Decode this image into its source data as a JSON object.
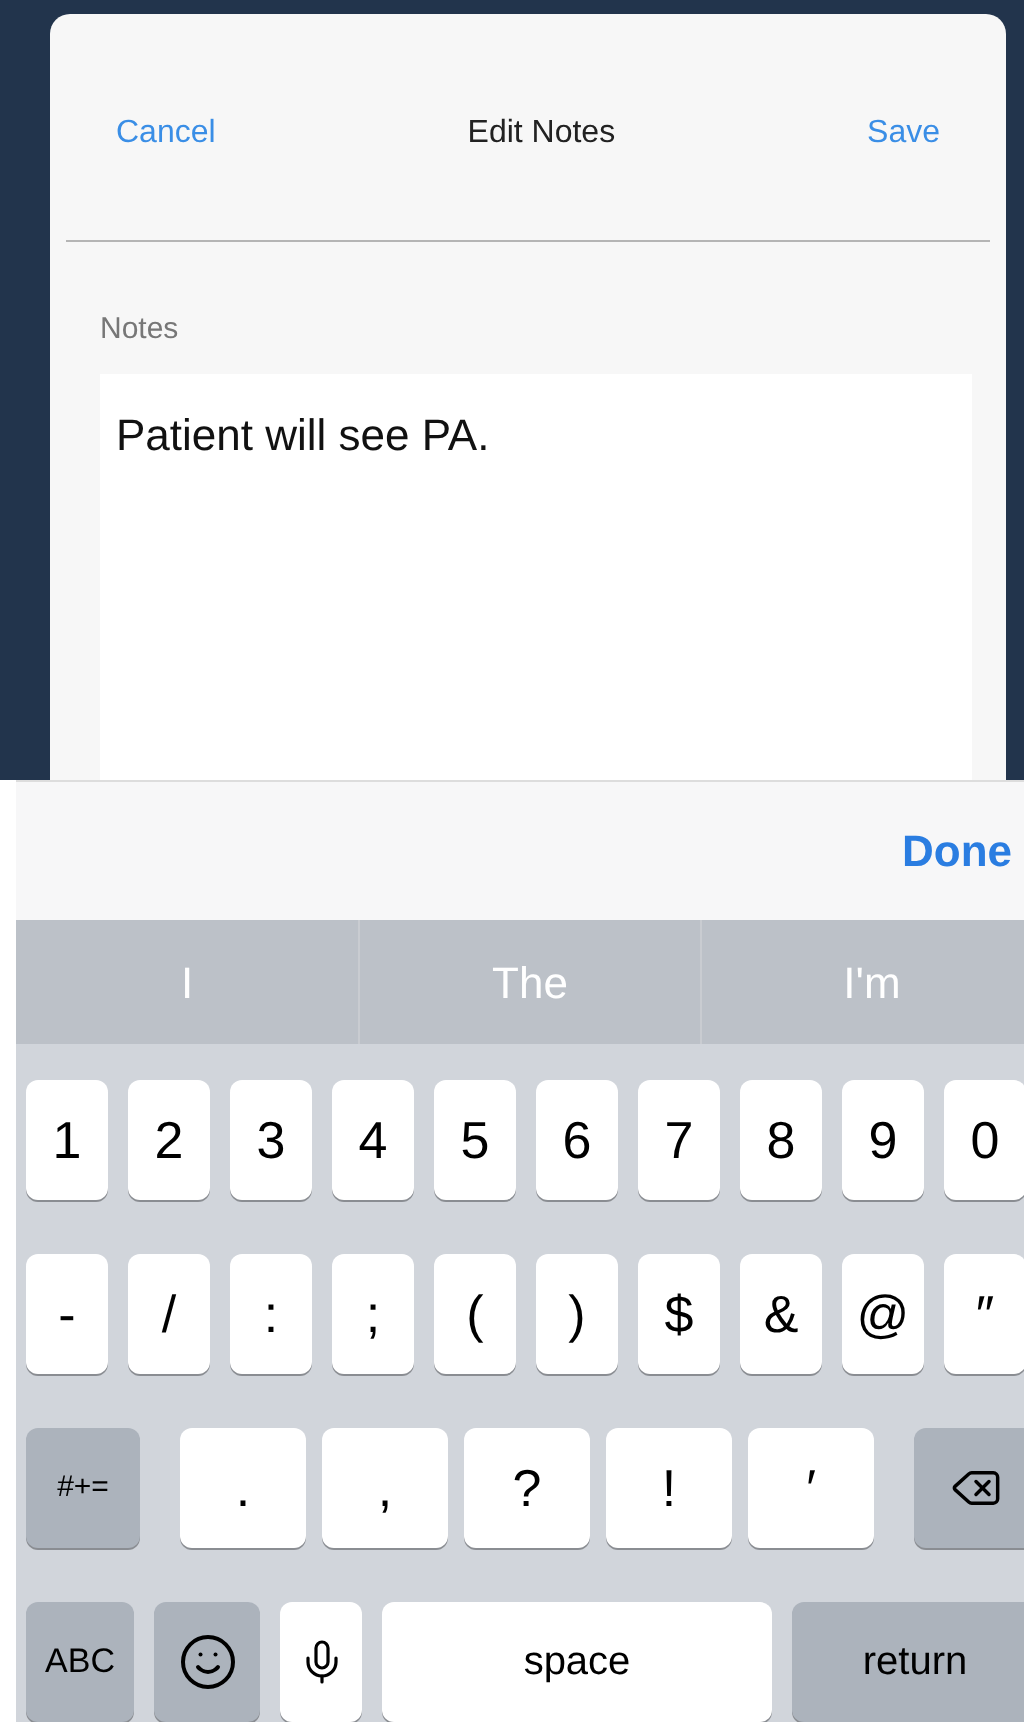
{
  "dialog": {
    "cancel": "Cancel",
    "title": "Edit Notes",
    "save": "Save"
  },
  "notes": {
    "label": "Notes",
    "value": "Patient will see PA."
  },
  "accessory_bar": {
    "done": "Done"
  },
  "suggestions": [
    "I",
    "The",
    "I'm"
  ],
  "keyboard": [
    {
      "kind": "numbers",
      "keys": [
        {
          "kind": "char",
          "label": "1"
        },
        {
          "kind": "char",
          "label": "2"
        },
        {
          "kind": "char",
          "label": "3"
        },
        {
          "kind": "char",
          "label": "4"
        },
        {
          "kind": "char",
          "label": "5"
        },
        {
          "kind": "char",
          "label": "6"
        },
        {
          "kind": "char",
          "label": "7"
        },
        {
          "kind": "char",
          "label": "8"
        },
        {
          "kind": "char",
          "label": "9"
        },
        {
          "kind": "char",
          "label": "0"
        }
      ]
    },
    {
      "kind": "symbols",
      "keys": [
        {
          "kind": "char",
          "label": "-"
        },
        {
          "kind": "char",
          "label": "/"
        },
        {
          "kind": "char",
          "label": ":"
        },
        {
          "kind": "char",
          "label": ";"
        },
        {
          "kind": "char",
          "label": "("
        },
        {
          "kind": "char",
          "label": ")"
        },
        {
          "kind": "char",
          "label": "$"
        },
        {
          "kind": "char",
          "label": "&"
        },
        {
          "kind": "char",
          "label": "@"
        },
        {
          "kind": "char",
          "label": "″"
        }
      ]
    },
    {
      "kind": "punctuation",
      "keys": [
        {
          "kind": "toggle",
          "label": "#+="
        },
        {
          "kind": "char",
          "label": "."
        },
        {
          "kind": "char",
          "label": ","
        },
        {
          "kind": "char",
          "label": "?"
        },
        {
          "kind": "char",
          "label": "!"
        },
        {
          "kind": "char",
          "label": "′"
        },
        {
          "kind": "backspace"
        }
      ]
    },
    {
      "kind": "bottom",
      "keys": [
        {
          "kind": "abc",
          "label": "ABC"
        },
        {
          "kind": "emoji"
        },
        {
          "kind": "mic"
        },
        {
          "kind": "space",
          "label": "space"
        },
        {
          "kind": "return",
          "label": "return"
        }
      ]
    }
  ]
}
